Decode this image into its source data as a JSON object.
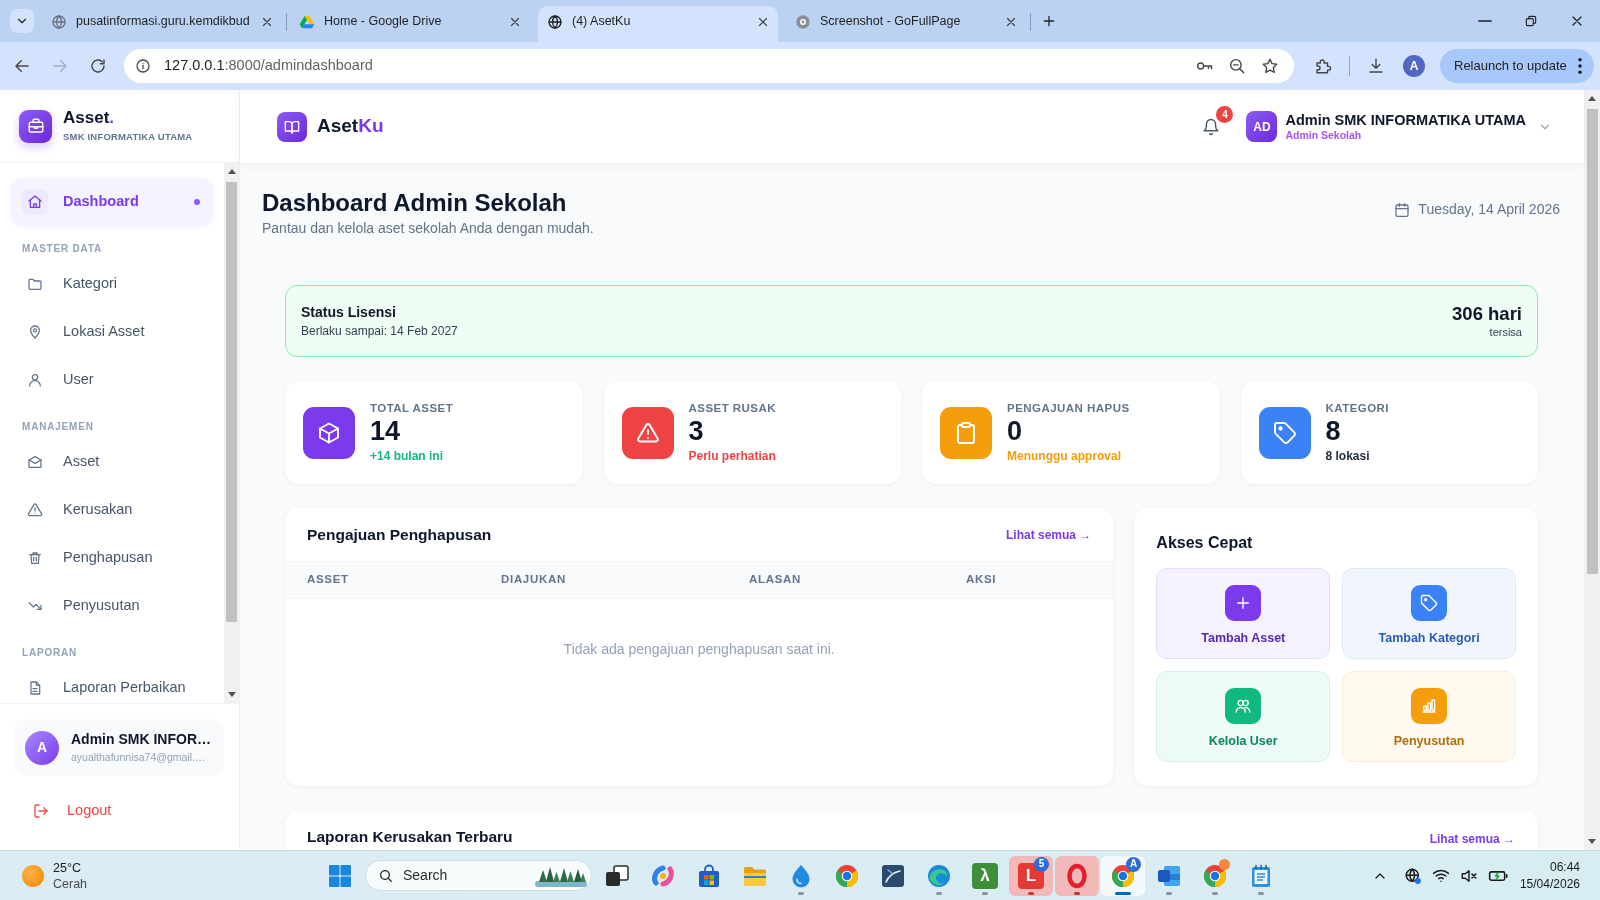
{
  "browser": {
    "tabs": [
      {
        "title": "pusatinformasi.guru.kemdikbud",
        "selected": false
      },
      {
        "title": "Home - Google Drive",
        "selected": false
      },
      {
        "title": "(4) AsetKu",
        "selected": true
      },
      {
        "title": "Screenshot - GoFullPage",
        "selected": false
      }
    ],
    "can_go_forward": false,
    "address": {
      "host": "127.0.0.1",
      "path": ":8000/admindashboard"
    },
    "profile_initial": "A",
    "update_button": "Relaunch to update"
  },
  "sidebar": {
    "brand": {
      "name": "Asset",
      "accent": "."
    },
    "school": "SMK INFORMATIKA UTAMA",
    "nav": [
      {
        "items": [
          {
            "label": "Dashboard",
            "selected": true
          }
        ]
      },
      {
        "heading": "MASTER DATA",
        "items": [
          {
            "label": "Kategori",
            "selected": false
          },
          {
            "label": "Lokasi Asset",
            "selected": false
          },
          {
            "label": "User",
            "selected": false
          }
        ]
      },
      {
        "heading": "MANAJEMEN",
        "items": [
          {
            "label": "Asset",
            "selected": false
          },
          {
            "label": "Kerusakan",
            "selected": false
          },
          {
            "label": "Penghapusan",
            "selected": false
          },
          {
            "label": "Penyusutan",
            "selected": false
          }
        ]
      },
      {
        "heading": "LAPORAN",
        "items": [
          {
            "label": "Laporan Perbaikan",
            "selected": false
          }
        ]
      }
    ],
    "user": {
      "initial": "A",
      "name": "Admin SMK INFOR…",
      "email": "ayualthafunnisa74@gmail.…"
    },
    "logout": "Logout"
  },
  "header": {
    "logo": {
      "name": "Aset",
      "accent": "Ku"
    },
    "notifications": "4",
    "user": {
      "initials": "AD",
      "name": "Admin SMK INFORMATIKA UTAMA",
      "role": "Admin Sekolah"
    }
  },
  "page": {
    "title": "Dashboard Admin Sekolah",
    "subtitle": "Pantau dan kelola aset sekolah Anda dengan mudah.",
    "date": "Tuesday, 14 April 2026"
  },
  "license": {
    "title": "Status Lisensi",
    "valid_until": "Berlaku sampai: 14 Feb 2027",
    "remaining": "306 hari",
    "remaining_label": "tersisa"
  },
  "stats": [
    {
      "label": "TOTAL ASSET",
      "value": "14",
      "note": {
        "text": "+14 bulan ini",
        "color": "#10b981"
      },
      "color": "#7c3aed"
    },
    {
      "label": "ASSET RUSAK",
      "value": "3",
      "note": {
        "text": "Perlu perhatian",
        "color": "#ef4444"
      },
      "color": "#ef4444"
    },
    {
      "label": "PENGAJUAN HAPUS",
      "value": "0",
      "note": {
        "text": "Menunggu approval",
        "color": "#f59e0b"
      },
      "color": "#f59e0b"
    },
    {
      "label": "KATEGORI",
      "value": "8",
      "note": {
        "text": "8 lokasi",
        "color": "#1e293b"
      },
      "color": "#3b82f6"
    }
  ],
  "deletion_requests": {
    "title": "Pengajuan Penghapusan",
    "link": "Lihat semua →",
    "columns": [
      "ASSET",
      "DIAJUKAN",
      "ALASAN",
      "AKSI"
    ],
    "empty_message": "Tidak ada pengajuan penghapusan saat ini."
  },
  "quick_access": {
    "title": "Akses Cepat",
    "actions": [
      {
        "label": "Tambah Asset",
        "color": "#7c3aed"
      },
      {
        "label": "Tambah Kategori",
        "color": "#3b82f6"
      },
      {
        "label": "Kelola User",
        "color": "#10b981"
      },
      {
        "label": "Penyusutan",
        "color": "#f59e0b"
      }
    ]
  },
  "damage_reports": {
    "title": "Laporan Kerusakan Terbaru",
    "link": "Lihat semua →"
  },
  "taskbar": {
    "weather": {
      "temperature": "25°C",
      "condition": "Cerah"
    },
    "search_placeholder": "Search",
    "apps": [
      {
        "open": false,
        "selected": false,
        "flashing": false
      },
      {
        "open": false,
        "selected": false,
        "flashing": false
      },
      {
        "open": false,
        "selected": false,
        "flashing": false
      },
      {
        "open": false,
        "selected": false,
        "flashing": false
      },
      {
        "open": true,
        "selected": false,
        "flashing": false
      },
      {
        "open": false,
        "selected": false,
        "flashing": false
      },
      {
        "open": false,
        "selected": false,
        "flashing": false
      },
      {
        "open": true,
        "selected": false,
        "flashing": false
      },
      {
        "glyph": "λ",
        "open": true,
        "selected": false,
        "flashing": false
      },
      {
        "glyph": "L",
        "badge": "5",
        "open": true,
        "selected": false,
        "flashing": true
      },
      {
        "open": true,
        "selected": false,
        "flashing": true
      },
      {
        "badge": "A",
        "open": true,
        "selected": true,
        "flashing": false
      },
      {
        "open": true,
        "selected": false,
        "flashing": false
      },
      {
        "open": true,
        "selected": false,
        "flashing": false
      },
      {
        "open": true,
        "selected": false,
        "flashing": false
      }
    ],
    "clock": {
      "time": "06:44",
      "date": "15/04/2026"
    }
  }
}
